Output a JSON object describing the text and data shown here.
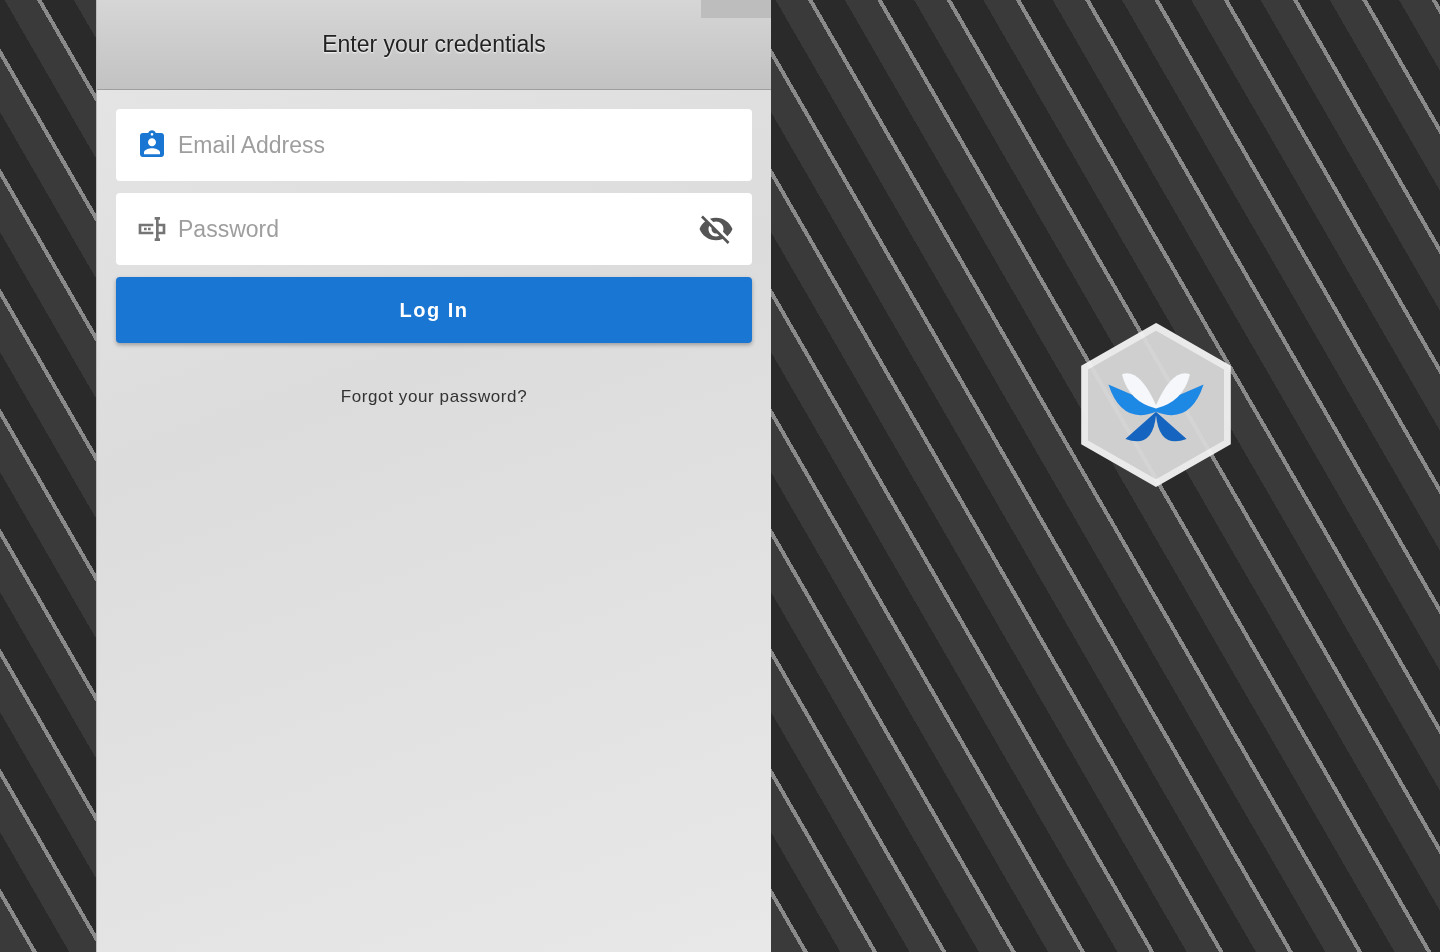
{
  "panel": {
    "title": "Enter your credentials"
  },
  "email": {
    "placeholder": "Email Address"
  },
  "password": {
    "placeholder": "Password",
    "visible": false
  },
  "login_button": "Log In",
  "forgot_link": "Forgot your password?"
}
